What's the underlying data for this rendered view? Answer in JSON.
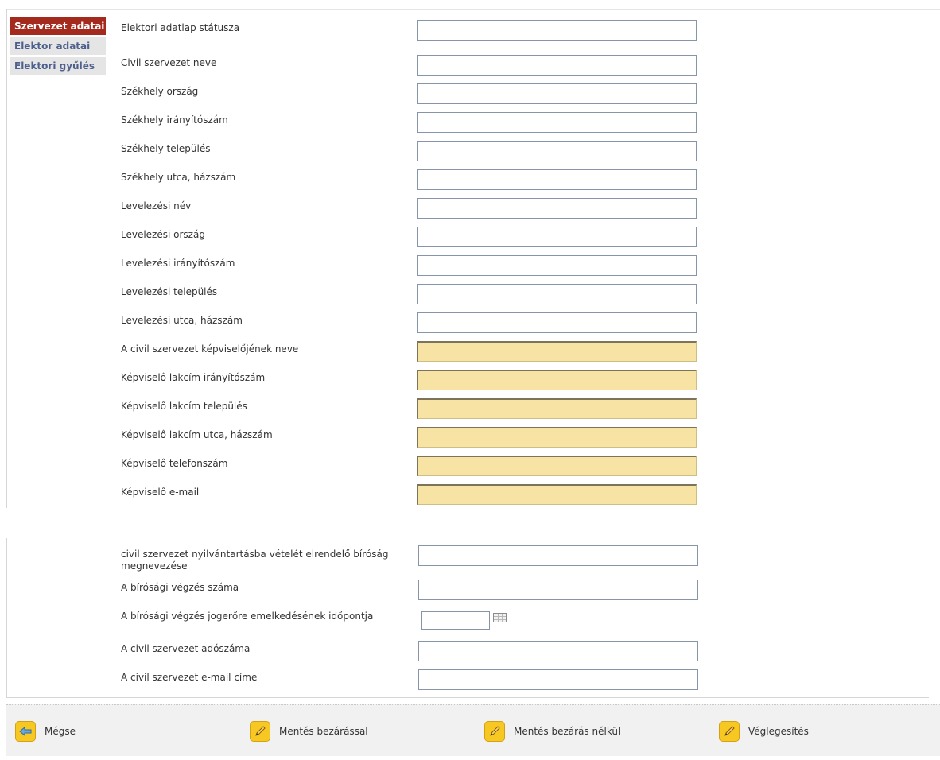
{
  "sidebar": {
    "items": [
      {
        "label": "Szervezet adatai",
        "active": true
      },
      {
        "label": "Elektor adatai",
        "active": false
      },
      {
        "label": "Elektori gyűlés",
        "active": false
      }
    ]
  },
  "form1": {
    "fields": [
      {
        "label": "Elektori adatlap státusza",
        "value": ""
      },
      {
        "label": "Civil szervezet neve",
        "value": ""
      },
      {
        "label": "Székhely ország",
        "value": ""
      },
      {
        "label": "Székhely irányítószám",
        "value": ""
      },
      {
        "label": "Székhely település",
        "value": ""
      },
      {
        "label": "Székhely utca, házszám",
        "value": ""
      },
      {
        "label": "Levelezési név",
        "value": ""
      },
      {
        "label": "Levelezési ország",
        "value": ""
      },
      {
        "label": "Levelezési irányítószám",
        "value": ""
      },
      {
        "label": "Levelezési település",
        "value": ""
      },
      {
        "label": "Levelezési utca, házszám",
        "value": ""
      },
      {
        "label": "A civil szervezet képviselőjének neve",
        "value": "",
        "required": true
      },
      {
        "label": "Képviselő lakcím irányítószám",
        "value": "",
        "required": true
      },
      {
        "label": "Képviselő lakcím település",
        "value": "",
        "required": true
      },
      {
        "label": "Képviselő lakcím utca, házszám",
        "value": "",
        "required": true
      },
      {
        "label": "Képviselő telefonszám",
        "value": "",
        "required": true
      },
      {
        "label": "Képviselő e-mail",
        "value": "",
        "required": true
      }
    ]
  },
  "form2": {
    "fields": [
      {
        "label": "civil szervezet nyilvántartásba vételét elrendelő bíróság megnevezése",
        "value": ""
      },
      {
        "label": "A bírósági végzés száma",
        "value": ""
      },
      {
        "label": "A bírósági végzés jogerőre emelkedésének időpontja",
        "value": ""
      },
      {
        "label": "A civil szervezet adószáma",
        "value": ""
      },
      {
        "label": "A civil szervezet e-mail címe",
        "value": ""
      }
    ],
    "calendar_icon": "calendar-icon"
  },
  "footer": {
    "cancel_label": "Mégse",
    "save_close_label": "Mentés bezárással",
    "save_noclose_label": "Mentés bezárás nélkül",
    "finalize_label": "Véglegesítés"
  },
  "colors": {
    "sidebar_active": "#a52a1e",
    "sidebar_inactive_text": "#4d5f8c",
    "required_field": "#f7e3a3",
    "footer_icon": "#f7c821"
  }
}
